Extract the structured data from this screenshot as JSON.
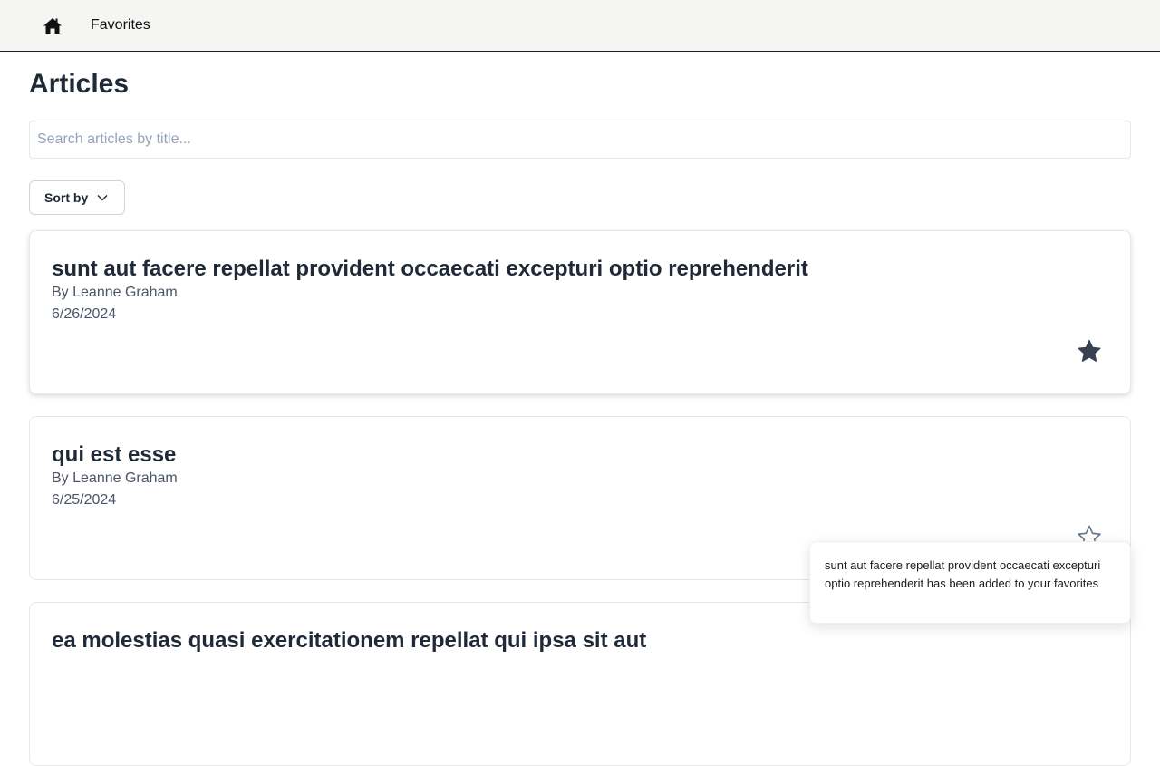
{
  "nav": {
    "home_icon": "home-icon",
    "favorites_label": "Favorites"
  },
  "page": {
    "title": "Articles"
  },
  "search": {
    "placeholder": "Search articles by title...",
    "value": ""
  },
  "sort": {
    "label": "Sort by",
    "icon": "chevron-down-icon"
  },
  "articles": [
    {
      "title": "sunt aut facere repellat provident occaecati excepturi optio reprehenderit",
      "author": "By Leanne Graham",
      "date": "6/26/2024",
      "favorited": true
    },
    {
      "title": "qui est esse",
      "author": "By Leanne Graham",
      "date": "6/25/2024",
      "favorited": false
    },
    {
      "title": "ea molestias quasi exercitationem repellat qui ipsa sit aut",
      "author": "",
      "date": "",
      "favorited": false
    }
  ],
  "toast": {
    "message": "sunt aut facere repellat provident occaecati excepturi optio reprehenderit has been added to your favorites"
  },
  "colors": {
    "star_filled": "#374151",
    "star_outline": "#64748b",
    "nav_bg": "#f5f5f4"
  }
}
